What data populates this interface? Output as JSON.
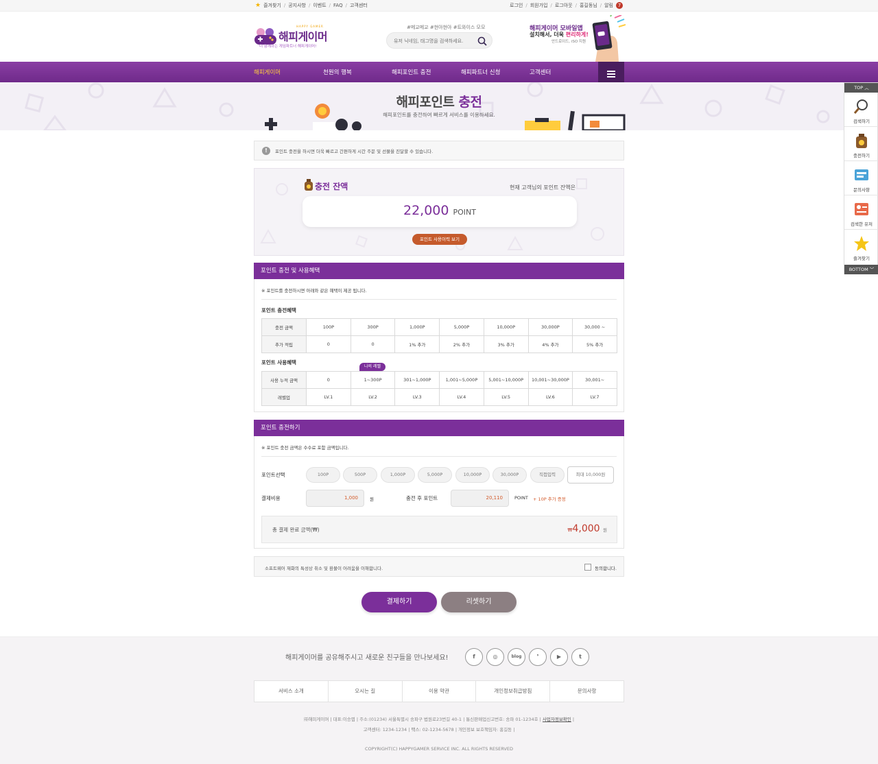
{
  "topbar": {
    "left": [
      "즐겨찾기",
      "공지사항",
      "이벤트",
      "FAQ",
      "고객센터"
    ],
    "right": [
      "로그인",
      "회원가입",
      "로그아웃",
      "홍길동님",
      "알림"
    ],
    "alarm_count": "7"
  },
  "header": {
    "logo_text": "해피게이머",
    "logo_small": "HAPPY GAMER",
    "logo_sub": "더 함께하는 게임파트너 해피게이머!",
    "hashtags": "#메교메교 #현아현아 #트와이스 모모",
    "search_placeholder": "유저 닉네임, 태그명을 검색하세요.",
    "promo_line1": "해피게이머 모바일앱",
    "promo_line2a": "설치해서, 더욱 ",
    "promo_line2b": "편리하게!",
    "promo_line3": "안드로이드, iSO 지원"
  },
  "nav": {
    "items": [
      "해피게이머",
      "천원의 행복",
      "해피포인트 충전",
      "해피파트너 신청",
      "고객센터"
    ]
  },
  "banner": {
    "title_a": "해피포인트 ",
    "title_b": "충전",
    "subtitle": "해피포인트를 충전하여 빠르게 서비스를 이용하세요."
  },
  "quick": {
    "top": "TOP",
    "bottom": "BOTTOM",
    "items": [
      "검색하기",
      "충전하기",
      "문의사항",
      "검색한 유저",
      "즐겨찾기"
    ]
  },
  "notice": {
    "text": "포인트 충전을 하시면 더욱 빠르고 간편하게 시간 주문 및 선물을 진달할 수 있습니다."
  },
  "balance": {
    "title": "충전 잔액",
    "desc": "현재 고객님의 포인트 잔액은",
    "amount": "22,000",
    "unit": "POINT",
    "history_button": "포인트 사용이력 보기"
  },
  "benefits": {
    "header": "포인트 충전 및 사용혜택",
    "note": "※ 포인트를 충전하시면 아래와 같은 혜택이 제공 됩니다.",
    "charge_title": "포인트 충전혜택",
    "charge_rows": [
      [
        "충전 금액",
        "100P",
        "300P",
        "1,000P",
        "5,000P",
        "10,000P",
        "30,000P",
        "30,000 ~"
      ],
      [
        "추가 적립",
        "0",
        "0",
        "1% 추가",
        "2% 추가",
        "3% 추가",
        "4% 추가",
        "5% 추가"
      ]
    ],
    "use_title": "포인트 사용혜택",
    "my_level_badge": "나의 레벨",
    "use_rows": [
      [
        "사용 누적 금액",
        "0",
        "1~300P",
        "301~1,000P",
        "1,001~5,000P",
        "5,001~10,000P",
        "10,001~30,000P",
        "30,001~"
      ],
      [
        "레벨업",
        "LV.1",
        "LV.2",
        "LV.3",
        "LV.4",
        "LV.5",
        "LV.6",
        "LV.7"
      ]
    ]
  },
  "charge": {
    "header": "포인트 충전하기",
    "note": "※ 포인트 충전 금액은 수수료 포함 금액입니다.",
    "select_label": "포인트선택",
    "options": [
      "100P",
      "500P",
      "1,000P",
      "5,000P",
      "10,000P",
      "30,000P",
      "직접입력"
    ],
    "max_option": "최대 10,000원",
    "cost_label": "결제비용",
    "cost_value": "1,000",
    "cost_unit": "원",
    "after_label": "충전 후 포인트",
    "after_value": "20,110",
    "after_unit": "POINT",
    "bonus": "+ 10P 추가 증정",
    "total_label": "총 결제 완료 금액(₩)",
    "total_currency": "₩",
    "total_amount": "4,000",
    "total_unit": "원"
  },
  "agree": {
    "text": "소프트웨어 재화의 특성상 취소 및 환불이 어려움을 이해합니다.",
    "label": "동의합니다."
  },
  "buttons": {
    "pay": "결제하기",
    "reset": "리셋하기"
  },
  "footer": {
    "share": "해피게이머를 공유해주시고 새로운 친구들을 만나보세요!",
    "sns": [
      "f",
      "◎",
      "blog",
      "❜",
      "▶",
      "t"
    ],
    "links": [
      "서비스 소개",
      "오시는 길",
      "이용 약관",
      "개인정보취급방침",
      "문의사항"
    ],
    "info1": "㈜해피게이머 | 대표:이승엽 | 주소:(01234) 서울특별시 송파구 법원로23번길 40-1 | 통신판매업신고번호: 송파 01-1234호 |",
    "info1_link": "사업자정보확인",
    "info2": "고객센터: 1234-1234 | 팩스: 02-1234-5678 | 개인정보 보호책임자: 홍길동 |",
    "copyright": "COPYRIGHT(C) HAPPYGAMER SERVICE INC. ALL RIGHTS RESERVED"
  },
  "colors": {
    "brand_purple": "#7b2f9a",
    "nav_active": "#ffcc3d",
    "history_button": "#c55a2c",
    "reset_button": "#8c7f82"
  }
}
